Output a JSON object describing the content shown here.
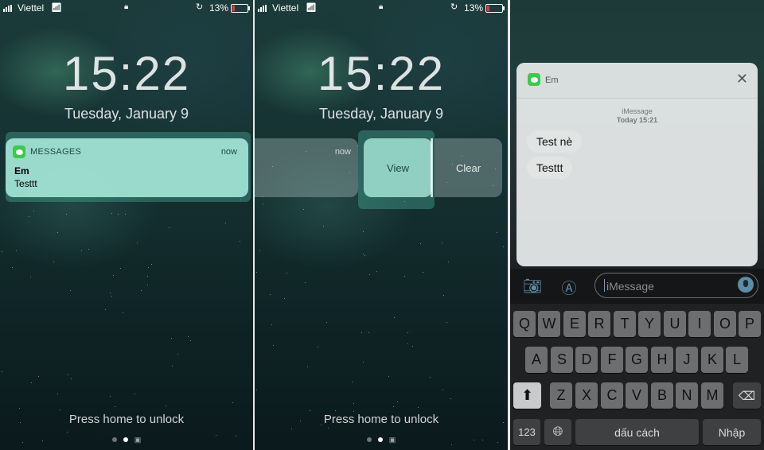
{
  "status": {
    "carrier": "Viettel",
    "battery_pct": "13%",
    "battery_level": 0.13
  },
  "lockscreen": {
    "time": "15:22",
    "date": "Tuesday, January 9",
    "unlock_hint": "Press home to unlock"
  },
  "notification": {
    "app_name": "MESSAGES",
    "time": "now",
    "sender": "Em",
    "body": "Testtt"
  },
  "actions": {
    "view_label": "View",
    "clear_label": "Clear",
    "time": "now"
  },
  "conversation": {
    "contact": "Em",
    "service": "iMessage",
    "timestamp": "Today 15:21",
    "messages": [
      "Test nè",
      "Testtt"
    ]
  },
  "composer": {
    "placeholder": "iMessage"
  },
  "keyboard": {
    "row1": [
      "Q",
      "W",
      "E",
      "R",
      "T",
      "Y",
      "U",
      "I",
      "O",
      "P"
    ],
    "row2": [
      "A",
      "S",
      "D",
      "F",
      "G",
      "H",
      "J",
      "K",
      "L"
    ],
    "row3": [
      "Z",
      "X",
      "C",
      "V",
      "B",
      "N",
      "M"
    ],
    "numbers_label": "123",
    "space_label": "dấu cách",
    "return_label": "Nhập"
  },
  "icons": [
    "messages-app-icon",
    "close-icon",
    "camera-icon",
    "app-store-icon",
    "microphone-icon",
    "shift-icon",
    "delete-icon",
    "globe-icon",
    "lock-icon",
    "wifi-icon",
    "rotation-lock-icon",
    "battery-icon"
  ]
}
